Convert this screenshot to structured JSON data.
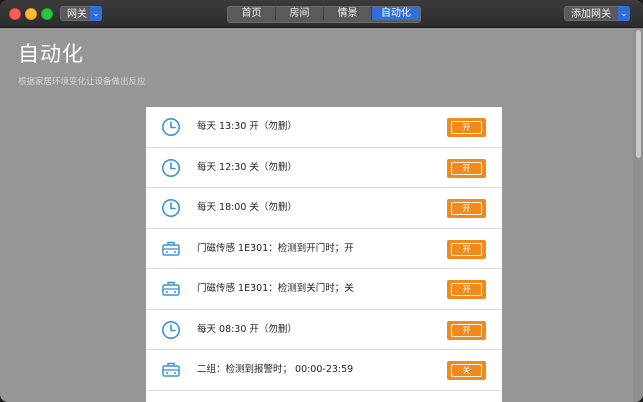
{
  "window": {
    "gateway_label": "网关",
    "add_gateway_label": "添加网关",
    "tabs": [
      {
        "label": "首页",
        "active": false
      },
      {
        "label": "房间",
        "active": false
      },
      {
        "label": "情景",
        "active": false
      },
      {
        "label": "自动化",
        "active": true
      }
    ]
  },
  "page": {
    "title": "自动化",
    "subtitle": "根据家居环境变化让设备做出反应"
  },
  "automations": [
    {
      "icon": "clock-icon",
      "text": "每天 13:30 开（勿删）",
      "state": "开"
    },
    {
      "icon": "clock-icon",
      "text": "每天 12:30 关（勿删）",
      "state": "开"
    },
    {
      "icon": "clock-icon",
      "text": "每天 18:00 关（勿删）",
      "state": "开"
    },
    {
      "icon": "sensor-icon",
      "text": "门磁传感 1E301：检测到开门时；开",
      "state": "开"
    },
    {
      "icon": "sensor-icon",
      "text": "门磁传感 1E301：检测到关门时；关",
      "state": "开"
    },
    {
      "icon": "clock-icon",
      "text": "每天 08:30 开（勿删）",
      "state": "开"
    },
    {
      "icon": "sensor-icon",
      "text": "二组：检测到报警时； 00:00-23:59",
      "state": "关"
    }
  ],
  "colors": {
    "accent": "#2f6fdc",
    "toggle": "#f08a1c",
    "icon": "#3a95d6",
    "background": "#969696"
  }
}
